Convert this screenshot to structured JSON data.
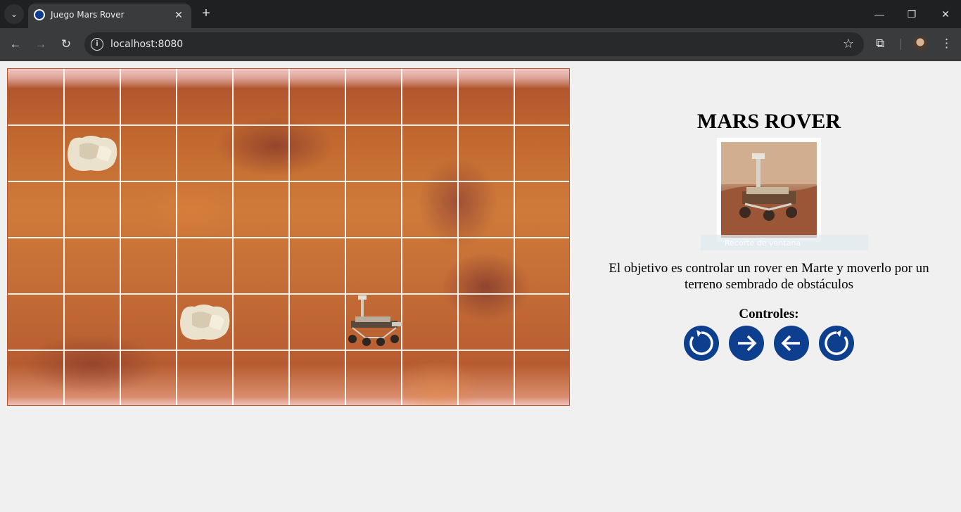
{
  "browser": {
    "tab_title": "Juego Mars Rover",
    "url": "localhost:8080",
    "icons": [
      "tab-search-icon",
      "nasa-favicon-icon",
      "close-icon",
      "new-tab-icon",
      "minimize-icon",
      "restore-icon",
      "close-window-icon",
      "back-icon",
      "forward-icon",
      "reload-icon",
      "site-info-icon",
      "bookmark-star-icon",
      "extensions-icon",
      "profile-avatar",
      "menu-icon"
    ]
  },
  "board": {
    "columns": 10,
    "rows": 6,
    "obstacles": [
      {
        "col": 1,
        "row": 1
      },
      {
        "col": 3,
        "row": 4
      }
    ],
    "rover": {
      "col": 6,
      "row": 4
    }
  },
  "panel": {
    "title": "MARS ROVER",
    "snip_label": "Recorte de ventana",
    "description": "El objetivo es controlar un rover en Marte y moverlo por un terreno sembrado de obstáculos",
    "controls_label": "Controles:",
    "buttons": [
      "rotate-left-icon",
      "arrow-right-icon",
      "arrow-left-icon",
      "rotate-right-icon"
    ]
  },
  "colors": {
    "button": "#0d3f8e",
    "background": "#f0f0f0",
    "board_border": "#c0542a"
  }
}
